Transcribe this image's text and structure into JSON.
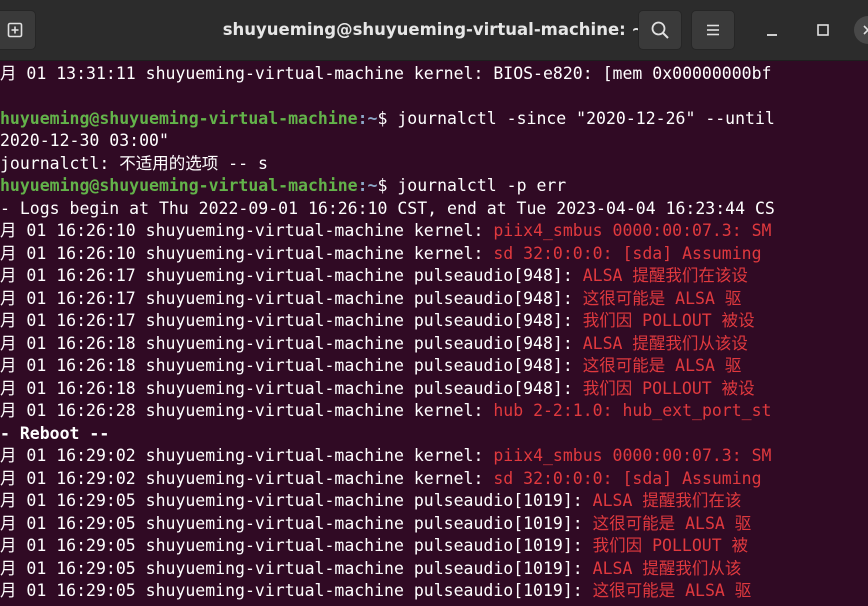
{
  "window": {
    "title": "shuyueming@shuyueming-virtual-machine: ~"
  },
  "terminal": {
    "lines": [
      {
        "parts": [
          {
            "t": "月 01 13:31:11 shuyueming-virtual-machine kernel: BIOS-e820: [mem 0x00000000bf",
            "c": "n"
          }
        ]
      },
      {
        "parts": []
      },
      {
        "parts": [
          {
            "t": "huyueming@shuyueming-virtual-machine",
            "c": "u"
          },
          {
            "t": ":~",
            "c": "p"
          },
          {
            "t": "$ journalctl -since \"2020-12-26\" --until",
            "c": "n"
          }
        ]
      },
      {
        "parts": [
          {
            "t": "2020-12-30 03:00\"",
            "c": "n"
          }
        ]
      },
      {
        "parts": [
          {
            "t": "journalctl: 不适用的选项 -- s",
            "c": "n"
          }
        ]
      },
      {
        "parts": [
          {
            "t": "huyueming@shuyueming-virtual-machine",
            "c": "u"
          },
          {
            "t": ":~",
            "c": "p"
          },
          {
            "t": "$ journalctl -p err",
            "c": "n"
          }
        ]
      },
      {
        "parts": [
          {
            "t": "- Logs begin at Thu 2022-09-01 16:26:10 CST, end at Tue 2023-04-04 16:23:44 CS",
            "c": "n"
          }
        ]
      },
      {
        "parts": [
          {
            "t": "月 01 16:26:10 shuyueming-virtual-machine kernel: ",
            "c": "n"
          },
          {
            "t": "piix4_smbus 0000:00:07.3: SM",
            "c": "e"
          }
        ]
      },
      {
        "parts": [
          {
            "t": "月 01 16:26:10 shuyueming-virtual-machine kernel: ",
            "c": "n"
          },
          {
            "t": "sd 32:0:0:0: [sda] Assuming",
            "c": "e"
          }
        ]
      },
      {
        "parts": [
          {
            "t": "月 01 16:26:17 shuyueming-virtual-machine pulseaudio[948]: ",
            "c": "n"
          },
          {
            "t": "ALSA 提醒我们在该设",
            "c": "e"
          }
        ]
      },
      {
        "parts": [
          {
            "t": "月 01 16:26:17 shuyueming-virtual-machine pulseaudio[948]: ",
            "c": "n"
          },
          {
            "t": "这很可能是 ALSA 驱",
            "c": "e"
          }
        ]
      },
      {
        "parts": [
          {
            "t": "月 01 16:26:17 shuyueming-virtual-machine pulseaudio[948]: ",
            "c": "n"
          },
          {
            "t": "我们因 POLLOUT 被设",
            "c": "e"
          }
        ]
      },
      {
        "parts": [
          {
            "t": "月 01 16:26:18 shuyueming-virtual-machine pulseaudio[948]: ",
            "c": "n"
          },
          {
            "t": "ALSA 提醒我们从该设",
            "c": "e"
          }
        ]
      },
      {
        "parts": [
          {
            "t": "月 01 16:26:18 shuyueming-virtual-machine pulseaudio[948]: ",
            "c": "n"
          },
          {
            "t": "这很可能是 ALSA 驱",
            "c": "e"
          }
        ]
      },
      {
        "parts": [
          {
            "t": "月 01 16:26:18 shuyueming-virtual-machine pulseaudio[948]: ",
            "c": "n"
          },
          {
            "t": "我们因 POLLOUT 被设",
            "c": "e"
          }
        ]
      },
      {
        "parts": [
          {
            "t": "月 01 16:26:28 shuyueming-virtual-machine kernel: ",
            "c": "n"
          },
          {
            "t": "hub 2-2:1.0: hub_ext_port_st",
            "c": "e"
          }
        ]
      },
      {
        "parts": [
          {
            "t": "- Reboot --",
            "c": "b"
          }
        ]
      },
      {
        "parts": [
          {
            "t": "月 01 16:29:02 shuyueming-virtual-machine kernel: ",
            "c": "n"
          },
          {
            "t": "piix4_smbus 0000:00:07.3: SM",
            "c": "e"
          }
        ]
      },
      {
        "parts": [
          {
            "t": "月 01 16:29:02 shuyueming-virtual-machine kernel: ",
            "c": "n"
          },
          {
            "t": "sd 32:0:0:0: [sda] Assuming",
            "c": "e"
          }
        ]
      },
      {
        "parts": [
          {
            "t": "月 01 16:29:05 shuyueming-virtual-machine pulseaudio[1019]: ",
            "c": "n"
          },
          {
            "t": "ALSA 提醒我们在该",
            "c": "e"
          }
        ]
      },
      {
        "parts": [
          {
            "t": "月 01 16:29:05 shuyueming-virtual-machine pulseaudio[1019]: ",
            "c": "n"
          },
          {
            "t": "这很可能是 ALSA 驱",
            "c": "e"
          }
        ]
      },
      {
        "parts": [
          {
            "t": "月 01 16:29:05 shuyueming-virtual-machine pulseaudio[1019]: ",
            "c": "n"
          },
          {
            "t": "我们因 POLLOUT 被",
            "c": "e"
          }
        ]
      },
      {
        "parts": [
          {
            "t": "月 01 16:29:05 shuyueming-virtual-machine pulseaudio[1019]: ",
            "c": "n"
          },
          {
            "t": "ALSA 提醒我们从该",
            "c": "e"
          }
        ]
      },
      {
        "parts": [
          {
            "t": "月 01 16:29:05 shuyueming-virtual-machine pulseaudio[1019]: ",
            "c": "n"
          },
          {
            "t": "这很可能是 ALSA 驱",
            "c": "e"
          }
        ]
      }
    ]
  },
  "icons": {
    "new_tab": "new-tab-icon",
    "search": "search-icon",
    "menu": "hamburger-menu-icon",
    "minimize": "minimize-icon",
    "maximize": "maximize-icon",
    "close": "close-icon"
  },
  "colors": {
    "terminal_bg": "#300a24",
    "titlebar_bg": "#2c2c2c",
    "prompt_user": "#63b34a",
    "prompt_path": "#8ea8c8",
    "error_text": "#e0393e",
    "text": "#ffffff"
  }
}
